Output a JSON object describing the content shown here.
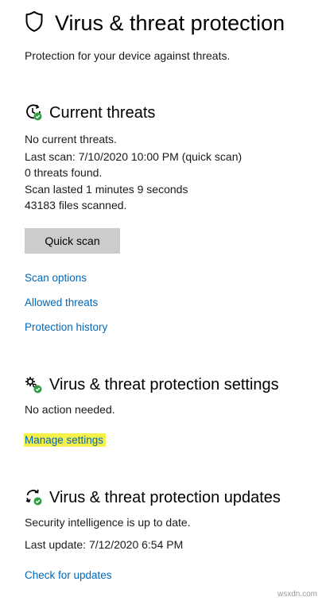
{
  "header": {
    "title": "Virus & threat protection",
    "subtitle": "Protection for your device against threats.",
    "icon": "shield-icon"
  },
  "current_threats": {
    "icon": "scan-clock-check-icon",
    "title": "Current threats",
    "lines": [
      "No current threats.",
      "Last scan: 7/10/2020 10:00 PM (quick scan)",
      "0 threats found.",
      "Scan lasted 1 minutes 9 seconds",
      "43183 files scanned."
    ],
    "quick_scan_label": "Quick scan",
    "links": [
      "Scan options",
      "Allowed threats",
      "Protection history"
    ]
  },
  "settings": {
    "icon": "gears-check-icon",
    "title": "Virus & threat protection settings",
    "status": "No action needed.",
    "manage_link": "Manage settings",
    "highlight_color": "#f6f04a"
  },
  "updates": {
    "icon": "refresh-check-icon",
    "title": "Virus & threat protection updates",
    "lines": [
      "Security intelligence is up to date.",
      "Last update: 7/12/2020 6:54 PM"
    ],
    "check_link": "Check for updates"
  },
  "watermark": "wsxdn.com",
  "colors": {
    "link": "#0067b8",
    "button_bg": "#cccccc",
    "status_green": "#2ea043"
  }
}
